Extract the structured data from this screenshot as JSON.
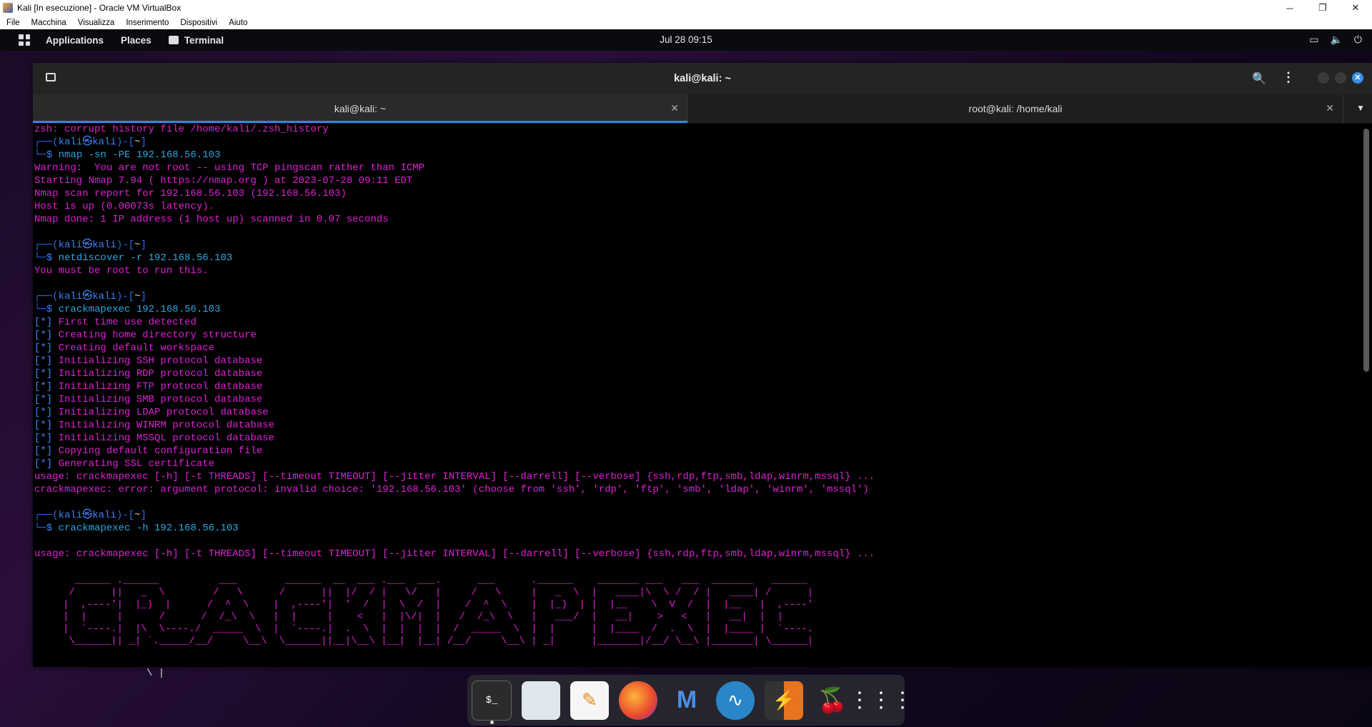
{
  "vbox": {
    "title": "Kali [In esecuzione] - Oracle VM VirtualBox",
    "menu": [
      "File",
      "Macchina",
      "Visualizza",
      "Inserimento",
      "Dispositivi",
      "Aiuto"
    ],
    "min": "─",
    "max": "❐",
    "close": "✕"
  },
  "panel": {
    "applications": "Applications",
    "places": "Places",
    "terminal": "Terminal",
    "clock": "Jul 28  09:15"
  },
  "window": {
    "title": "kali@kali: ~",
    "tabs": [
      {
        "label": "kali@kali: ~",
        "active": true
      },
      {
        "label": "root@kali: /home/kali",
        "active": false
      }
    ]
  },
  "terminal": {
    "l01": "zsh: corrupt history file /home/kali/.zsh_history",
    "p1_user": "kali㉿kali",
    "p1_dir": "~",
    "p1_cmd": "nmap",
    "p1_args": " -sn -PE 192.168.56.103",
    "l03": "Warning:  You are not root -- using TCP pingscan rather than ICMP",
    "l04": "Starting Nmap 7.94 ( https://nmap.org ) at 2023-07-28 09:11 EDT",
    "l05": "Nmap scan report for 192.168.56.103 (192.168.56.103)",
    "l06": "Host is up (0.00073s latency).",
    "l07": "Nmap done: 1 IP address (1 host up) scanned in 0.07 seconds",
    "p2_user": "kali㉿kali",
    "p2_dir": "~",
    "p2_cmd": "netdiscover",
    "p2_args": " -r 192.168.56.103",
    "l09": "You must be root to run this.",
    "p3_user": "kali㉿kali",
    "p3_dir": "~",
    "p3_cmd": "crackmapexec",
    "p3_args": " 192.168.56.103",
    "info": [
      "First time use detected",
      "Creating home directory structure",
      "Creating default workspace",
      "Initializing SSH protocol database",
      "Initializing RDP protocol database",
      "Initializing FTP protocol database",
      "Initializing SMB protocol database",
      "Initializing LDAP protocol database",
      "Initializing WINRM protocol database",
      "Initializing MSSQL protocol database",
      "Copying default configuration file",
      "Generating SSL certificate"
    ],
    "info_prefix": "[*]",
    "usage1": "usage: crackmapexec [-h] [-t THREADS] [--timeout TIMEOUT] [--jitter INTERVAL] [--darrell] [--verbose] {ssh,rdp,ftp,smb,ldap,winrm,mssql} ...",
    "error1": "crackmapexec: error: argument protocol: invalid choice: '192.168.56.103' (choose from 'ssh', 'rdp', 'ftp', 'smb', 'ldap', 'winrm', 'mssql')",
    "p4_user": "kali㉿kali",
    "p4_dir": "~",
    "p4_cmd": "crackmapexec",
    "p4_args": " -h 192.168.56.103",
    "usage2": "usage: crackmapexec [-h] [-t THREADS] [--timeout TIMEOUT] [--jitter INTERVAL] [--darrell] [--verbose] {ssh,rdp,ftp,smb,ldap,winrm,mssql} ...",
    "banner": "  ______ .______          ___        ______  __  ___ .___  ___.      ___      .______    _______ ___   ___  _______   ______\n /      ||   _  \\        /   \\      /      ||  |/  / |   \\/   |     /   \\     |   _  \\  |   ____|\\  \\ /  / |   ____| /      |\n|  ,----'|  |_)  |      /  ^  \\    |  ,----'|  '  /  |  \\  /  |    /  ^  \\    |  |_)  | |  |__    \\  V  /  |  |__   |  ,----'\n|  |     |      /      /  /_\\  \\   |  |     |    <   |  |\\/|  |   /  /_\\  \\   |   ___/  |   __|    >   <   |   __|  |  |\n|  `----.|  |\\  \\----./  _____  \\  |  `----.|  .  \\  |  |  |  |  /  _____  \\  |  |      |  |____  /  .  \\  |  |____ |  `----.\n \\______|| _| `._____/__/     \\__\\  \\______||__|\\__\\ |__|  |__| /__/     \\__\\ | _|      |_______|/__/ \\__\\ |_______| \\______|"
  },
  "below": "\\   |",
  "dock": [
    "terminal-icon",
    "files-icon",
    "text-editor-icon",
    "firefox-icon",
    "metasploit-icon",
    "wireshark-icon",
    "burpsuite-icon",
    "cherrytree-icon",
    "app-grid-icon"
  ]
}
